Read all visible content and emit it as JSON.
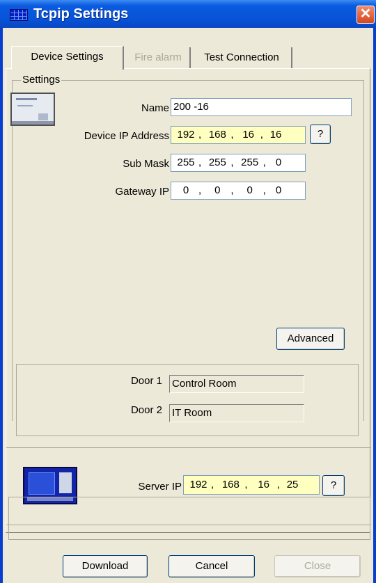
{
  "window": {
    "title": "Tcpip Settings",
    "close_symbol": "✕"
  },
  "tabs": [
    {
      "label": "Device Settings",
      "state": "active"
    },
    {
      "label": "Fire alarm",
      "state": "disabled"
    },
    {
      "label": "Test Connection",
      "state": "normal"
    }
  ],
  "settings": {
    "legend": "Settings",
    "name_label": "Name",
    "name_value": "200 -16",
    "ip_label": "Device IP Address",
    "ip": [
      "192",
      "168",
      "16",
      "16"
    ],
    "mask_label": "Sub Mask",
    "mask": [
      "255",
      "255",
      "255",
      "0"
    ],
    "gateway_label": "Gateway IP",
    "gateway": [
      "0",
      "0",
      "0",
      "0"
    ],
    "help_label": "?",
    "advanced_label": "Advanced"
  },
  "doors": {
    "door1_label": "Door 1",
    "door1_value": "Control Room",
    "door2_label": "Door 2",
    "door2_value": "IT Room"
  },
  "server": {
    "label": "Server IP",
    "ip": [
      "192",
      "168",
      "16",
      "25"
    ],
    "help_label": "?"
  },
  "footer": {
    "download_label": "Download",
    "cancel_label": "Cancel",
    "close_label": "Close"
  },
  "separator": ",",
  "colors": {
    "title_bar": "#0753d8",
    "ip_highlight": "#ffffc0",
    "dialog_bg": "#ece9d8"
  }
}
